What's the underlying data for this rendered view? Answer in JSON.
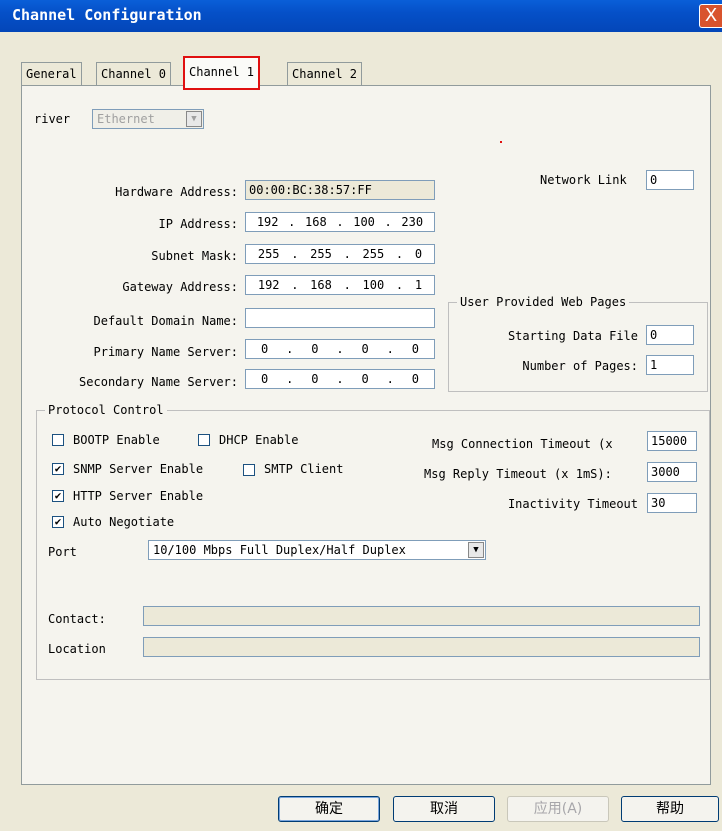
{
  "window": {
    "title": "Channel Configuration",
    "close_label": "X"
  },
  "tabs": [
    {
      "label": "General"
    },
    {
      "label": "Channel 0"
    },
    {
      "label": "Channel 1"
    },
    {
      "label": "Channel 2"
    }
  ],
  "driver": {
    "label": "Driver",
    "visible_label": "river",
    "value": "Ethernet"
  },
  "network": {
    "hardware_address_label": "Hardware Address:",
    "hardware_address": "00:00:BC:38:57:FF",
    "ip_label": "IP Address:",
    "ip": [
      "192",
      "168",
      "100",
      "230"
    ],
    "subnet_label": "Subnet Mask:",
    "subnet": [
      "255",
      "255",
      "255",
      "0"
    ],
    "gateway_label": "Gateway Address:",
    "gateway": [
      "192",
      "168",
      "100",
      "1"
    ],
    "domain_label": "Default Domain Name:",
    "domain": "",
    "primary_dns_label": "Primary Name Server:",
    "primary_dns": [
      "0",
      "0",
      "0",
      "0"
    ],
    "secondary_dns_label": "Secondary Name Server:",
    "secondary_dns": [
      "0",
      "0",
      "0",
      "0"
    ],
    "network_link_label": "Network Link",
    "network_link": "0"
  },
  "web_pages": {
    "title": "User Provided Web Pages",
    "start_label": "Starting Data File",
    "start": "0",
    "pages_label": "Number of Pages:",
    "pages": "1"
  },
  "protocol": {
    "title": "Protocol Control",
    "bootp": {
      "label": "BOOTP Enable",
      "checked": false
    },
    "dhcp": {
      "label": "DHCP Enable",
      "checked": false
    },
    "snmp": {
      "label": "SNMP Server Enable",
      "checked": true
    },
    "smtp": {
      "label": "SMTP Client",
      "checked": false
    },
    "http": {
      "label": "HTTP Server Enable",
      "checked": true
    },
    "auto": {
      "label": "Auto Negotiate",
      "checked": true
    },
    "msg_conn_label": "Msg Connection Timeout (x",
    "msg_conn": "15000",
    "msg_reply_label": "Msg Reply Timeout (x 1mS):",
    "msg_reply": "3000",
    "inactivity_label": "Inactivity Timeout",
    "inactivity": "30",
    "port_label": "Port",
    "port_value": "10/100 Mbps Full Duplex/Half Duplex",
    "contact_label": "Contact:",
    "contact": "",
    "location_label": "Location",
    "location": ""
  },
  "buttons": {
    "ok": "确定",
    "cancel": "取消",
    "apply": "应用(A)",
    "help": "帮助"
  },
  "icons": {
    "check": "✔",
    "dropdown": "▼",
    "close": "✕"
  }
}
